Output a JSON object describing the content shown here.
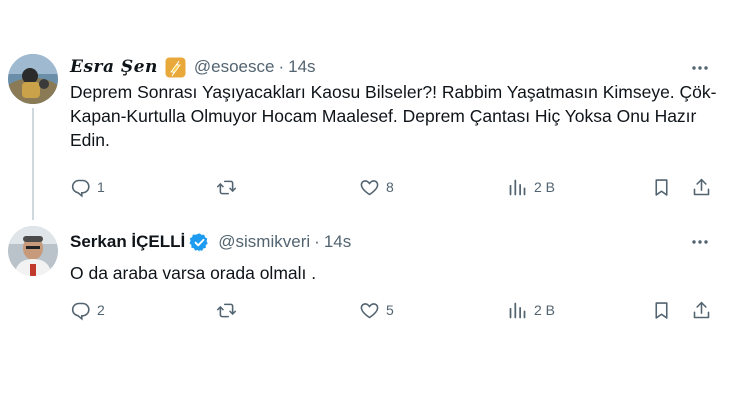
{
  "tweets": [
    {
      "display_name": "Esra Şen",
      "handle": "@esoesce",
      "separator": "·",
      "time": "14s",
      "text": "Deprem Sonrası Yaşıyacakları Kaosu Bilseler?! Rabbim Yaşatmasın Kimseye. Çök-Kapan-Kurtulla Olmuyor Hocam Maalesef. Deprem Çantası Hiç Yoksa Onu Hazır Edin.",
      "replies": "1",
      "retweets": "",
      "likes": "8",
      "views": "2 B",
      "badge": "gold-star-emoji"
    },
    {
      "display_name": "Serkan İÇELLİ",
      "handle": "@sismikveri",
      "separator": "·",
      "time": "14s",
      "text": "O da araba varsa orada olmalı .",
      "replies": "2",
      "retweets": "",
      "likes": "5",
      "views": "2 B",
      "badge": "verified-badge",
      "badge_color": "#1d9bf0"
    }
  ],
  "icons": {
    "reply": "reply-icon",
    "retweet": "retweet-icon",
    "like": "heart-icon",
    "views": "views-icon",
    "bookmark": "bookmark-icon",
    "share": "share-icon",
    "more": "more-icon"
  }
}
